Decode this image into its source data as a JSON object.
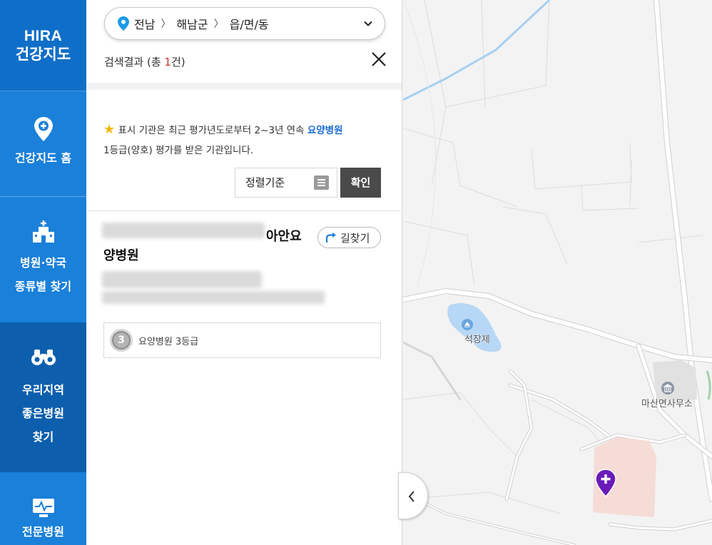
{
  "nav": {
    "logo_line1": "HIRA",
    "logo_line2": "건강지도",
    "items": [
      {
        "label": "건강지도 홈"
      },
      {
        "label": "병원·약국\n종류별 찾기"
      },
      {
        "label": "우리지역\n좋은병원\n찾기"
      },
      {
        "label": "전문병원"
      }
    ]
  },
  "location": {
    "region1": "전남",
    "region2": "해남군",
    "region3": "읍/면/동"
  },
  "results": {
    "prefix": "검색결과 (총 ",
    "count": "1",
    "suffix": "건)"
  },
  "notice": {
    "text1": "표시 기관은 최근 평가년도로부터 2~3년 연속 ",
    "highlight": "요양병원",
    "text2": "1등급(양호) 평가를 받은 기관입니다."
  },
  "sort": {
    "label": "정렬기준",
    "confirm": "확인"
  },
  "hospital": {
    "name_visible_tail": "아안요",
    "name_line2": "양병원",
    "route_label": "길찾기",
    "grade_number": "3",
    "grade_text": "요양병원 3등급"
  },
  "map": {
    "labels": {
      "lake": "석장제",
      "office": "마산면사무소"
    }
  },
  "colors": {
    "accent": "#1a80d9",
    "hospital_marker": "#6a1ab8",
    "highlight": "#1b6cd1"
  }
}
